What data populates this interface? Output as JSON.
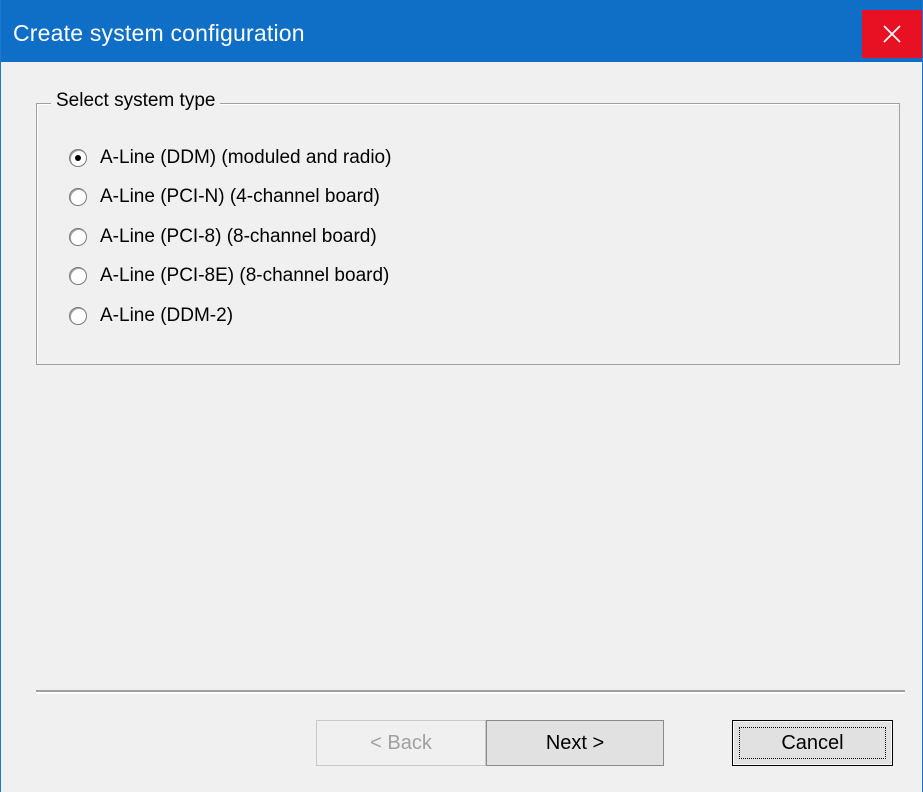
{
  "window": {
    "title": "Create system configuration",
    "close_icon": "close-icon"
  },
  "group": {
    "legend": "Select system type",
    "options": [
      {
        "label": "A-Line (DDM) (moduled and radio)",
        "selected": true
      },
      {
        "label": "A-Line (PCI-N) (4-channel board)",
        "selected": false
      },
      {
        "label": "A-Line (PCI-8) (8-channel board)",
        "selected": false
      },
      {
        "label": "A-Line (PCI-8E) (8-channel board)",
        "selected": false
      },
      {
        "label": "A-Line (DDM-2)",
        "selected": false
      }
    ]
  },
  "buttons": {
    "back": "< Back",
    "next": "Next >",
    "cancel": "Cancel"
  },
  "colors": {
    "titlebar": "#0f6fc6",
    "close": "#e81123",
    "dialog_bg": "#f0f0f0"
  }
}
